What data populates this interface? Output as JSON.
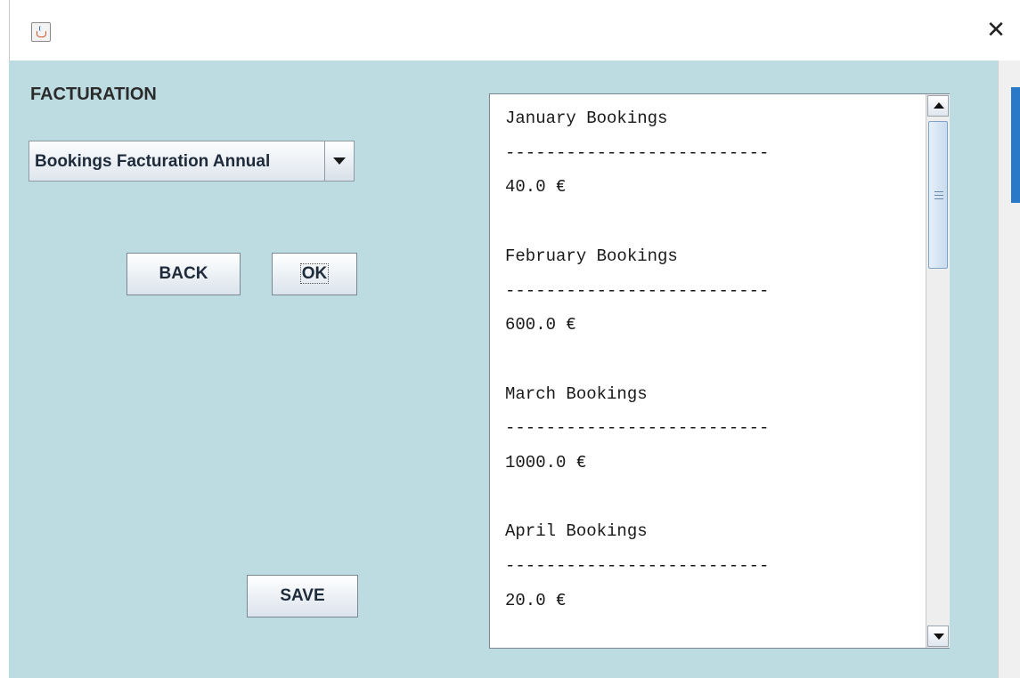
{
  "window": {
    "title": "",
    "close_glyph": "✕",
    "icon": "java-app-icon"
  },
  "panel": {
    "heading": "FACTURATION",
    "report_select": {
      "selected": "Bookings Facturation Annual"
    },
    "buttons": {
      "back": "BACK",
      "ok": "OK",
      "save": "SAVE"
    }
  },
  "report": {
    "lines": [
      "January Bookings",
      "--------------------------",
      "40.0 €",
      "",
      "February Bookings",
      "--------------------------",
      "600.0 €",
      "",
      "March Bookings",
      "--------------------------",
      "1000.0 €",
      "",
      "April Bookings",
      "--------------------------",
      "20.0 €"
    ]
  },
  "colors": {
    "client_background": "#bddce1",
    "scroll_thumb": "#c9dbee"
  }
}
